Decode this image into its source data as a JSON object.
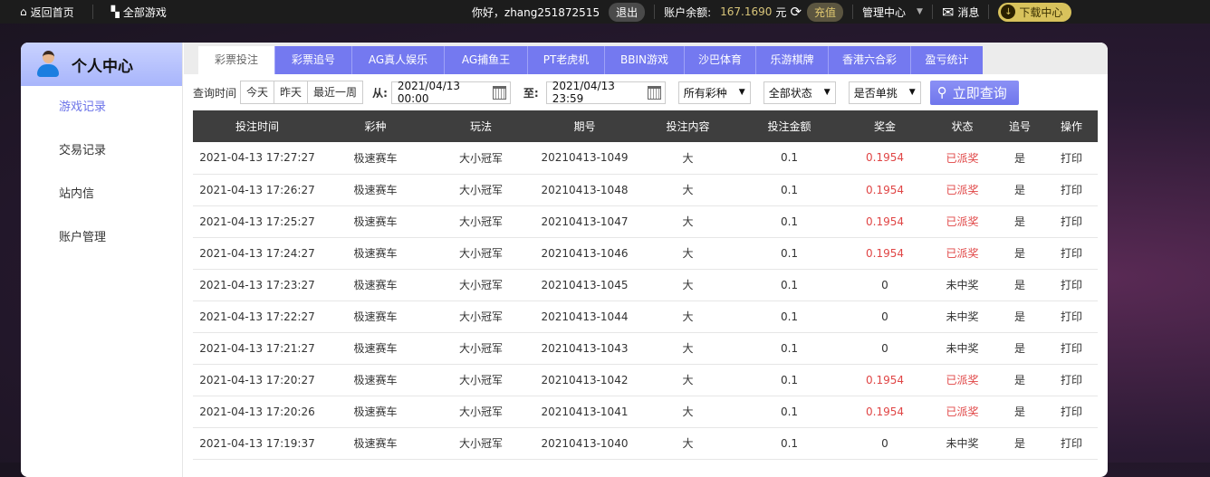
{
  "topbar": {
    "home": "返回首页",
    "all_games": "全部游戏",
    "greeting": "你好，zhang251872515",
    "logout": "退出",
    "balance_label": "账户余额:",
    "balance": "167.1690",
    "currency": "元",
    "recharge": "充值",
    "admin": "管理中心",
    "messages": "消息",
    "download": "下载中心"
  },
  "sidebar": {
    "title": "个人中心",
    "items": [
      "游戏记录",
      "交易记录",
      "站内信",
      "账户管理"
    ]
  },
  "tabs": [
    "彩票投注",
    "彩票追号",
    "AG真人娱乐",
    "AG捕鱼王",
    "PT老虎机",
    "BBIN游戏",
    "沙巴体育",
    "乐游棋牌",
    "香港六合彩",
    "盈亏统计"
  ],
  "filter": {
    "label": "查询时间",
    "quick": [
      "今天",
      "昨天",
      "最近一周"
    ],
    "from_label": "从:",
    "from": "2021/04/13 00:00",
    "to_label": "至:",
    "to": "2021/04/13 23:59",
    "lottery": "所有彩种",
    "status": "全部状态",
    "single": "是否单挑",
    "query": "立即查询"
  },
  "table": {
    "headers": [
      "投注时间",
      "彩种",
      "玩法",
      "期号",
      "投注内容",
      "投注金额",
      "奖金",
      "状态",
      "追号",
      "操作"
    ],
    "rows": [
      [
        "2021-04-13 17:27:27",
        "极速赛车",
        "大小冠军",
        "20210413-1049",
        "大",
        "0.1",
        "0.1954",
        "已派奖",
        "是",
        "打印"
      ],
      [
        "2021-04-13 17:26:27",
        "极速赛车",
        "大小冠军",
        "20210413-1048",
        "大",
        "0.1",
        "0.1954",
        "已派奖",
        "是",
        "打印"
      ],
      [
        "2021-04-13 17:25:27",
        "极速赛车",
        "大小冠军",
        "20210413-1047",
        "大",
        "0.1",
        "0.1954",
        "已派奖",
        "是",
        "打印"
      ],
      [
        "2021-04-13 17:24:27",
        "极速赛车",
        "大小冠军",
        "20210413-1046",
        "大",
        "0.1",
        "0.1954",
        "已派奖",
        "是",
        "打印"
      ],
      [
        "2021-04-13 17:23:27",
        "极速赛车",
        "大小冠军",
        "20210413-1045",
        "大",
        "0.1",
        "0",
        "未中奖",
        "是",
        "打印"
      ],
      [
        "2021-04-13 17:22:27",
        "极速赛车",
        "大小冠军",
        "20210413-1044",
        "大",
        "0.1",
        "0",
        "未中奖",
        "是",
        "打印"
      ],
      [
        "2021-04-13 17:21:27",
        "极速赛车",
        "大小冠军",
        "20210413-1043",
        "大",
        "0.1",
        "0",
        "未中奖",
        "是",
        "打印"
      ],
      [
        "2021-04-13 17:20:27",
        "极速赛车",
        "大小冠军",
        "20210413-1042",
        "大",
        "0.1",
        "0.1954",
        "已派奖",
        "是",
        "打印"
      ],
      [
        "2021-04-13 17:20:26",
        "极速赛车",
        "大小冠军",
        "20210413-1041",
        "大",
        "0.1",
        "0.1954",
        "已派奖",
        "是",
        "打印"
      ],
      [
        "2021-04-13 17:19:37",
        "极速赛车",
        "大小冠军",
        "20210413-1040",
        "大",
        "0.1",
        "0",
        "未中奖",
        "是",
        "打印"
      ]
    ]
  },
  "colors": {
    "accent": "#7479f0",
    "win": "#e04545",
    "header": "#3e3e3e"
  }
}
